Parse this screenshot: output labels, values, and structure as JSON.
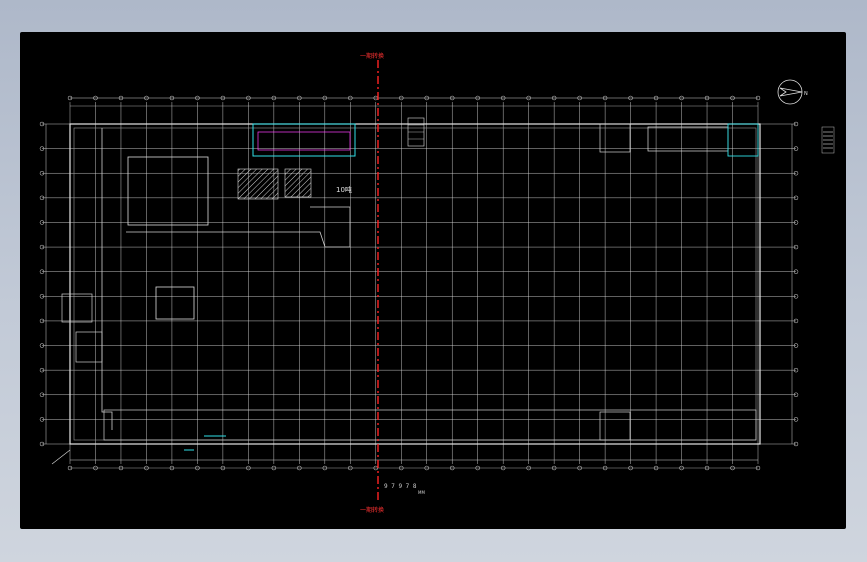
{
  "drawing": {
    "section_marker_label": "一期转换",
    "room_label_center": "10吨",
    "bottom_dimension_text": "9 7 9 7 8",
    "bottom_dimension_unit": "MM",
    "north_arrow_label": "N",
    "colors": {
      "background": "#000000",
      "grid": "#d8d8d8",
      "section_line": "#ff2222",
      "highlight": "#2fe0e8",
      "accent": "#ff40ff"
    }
  }
}
